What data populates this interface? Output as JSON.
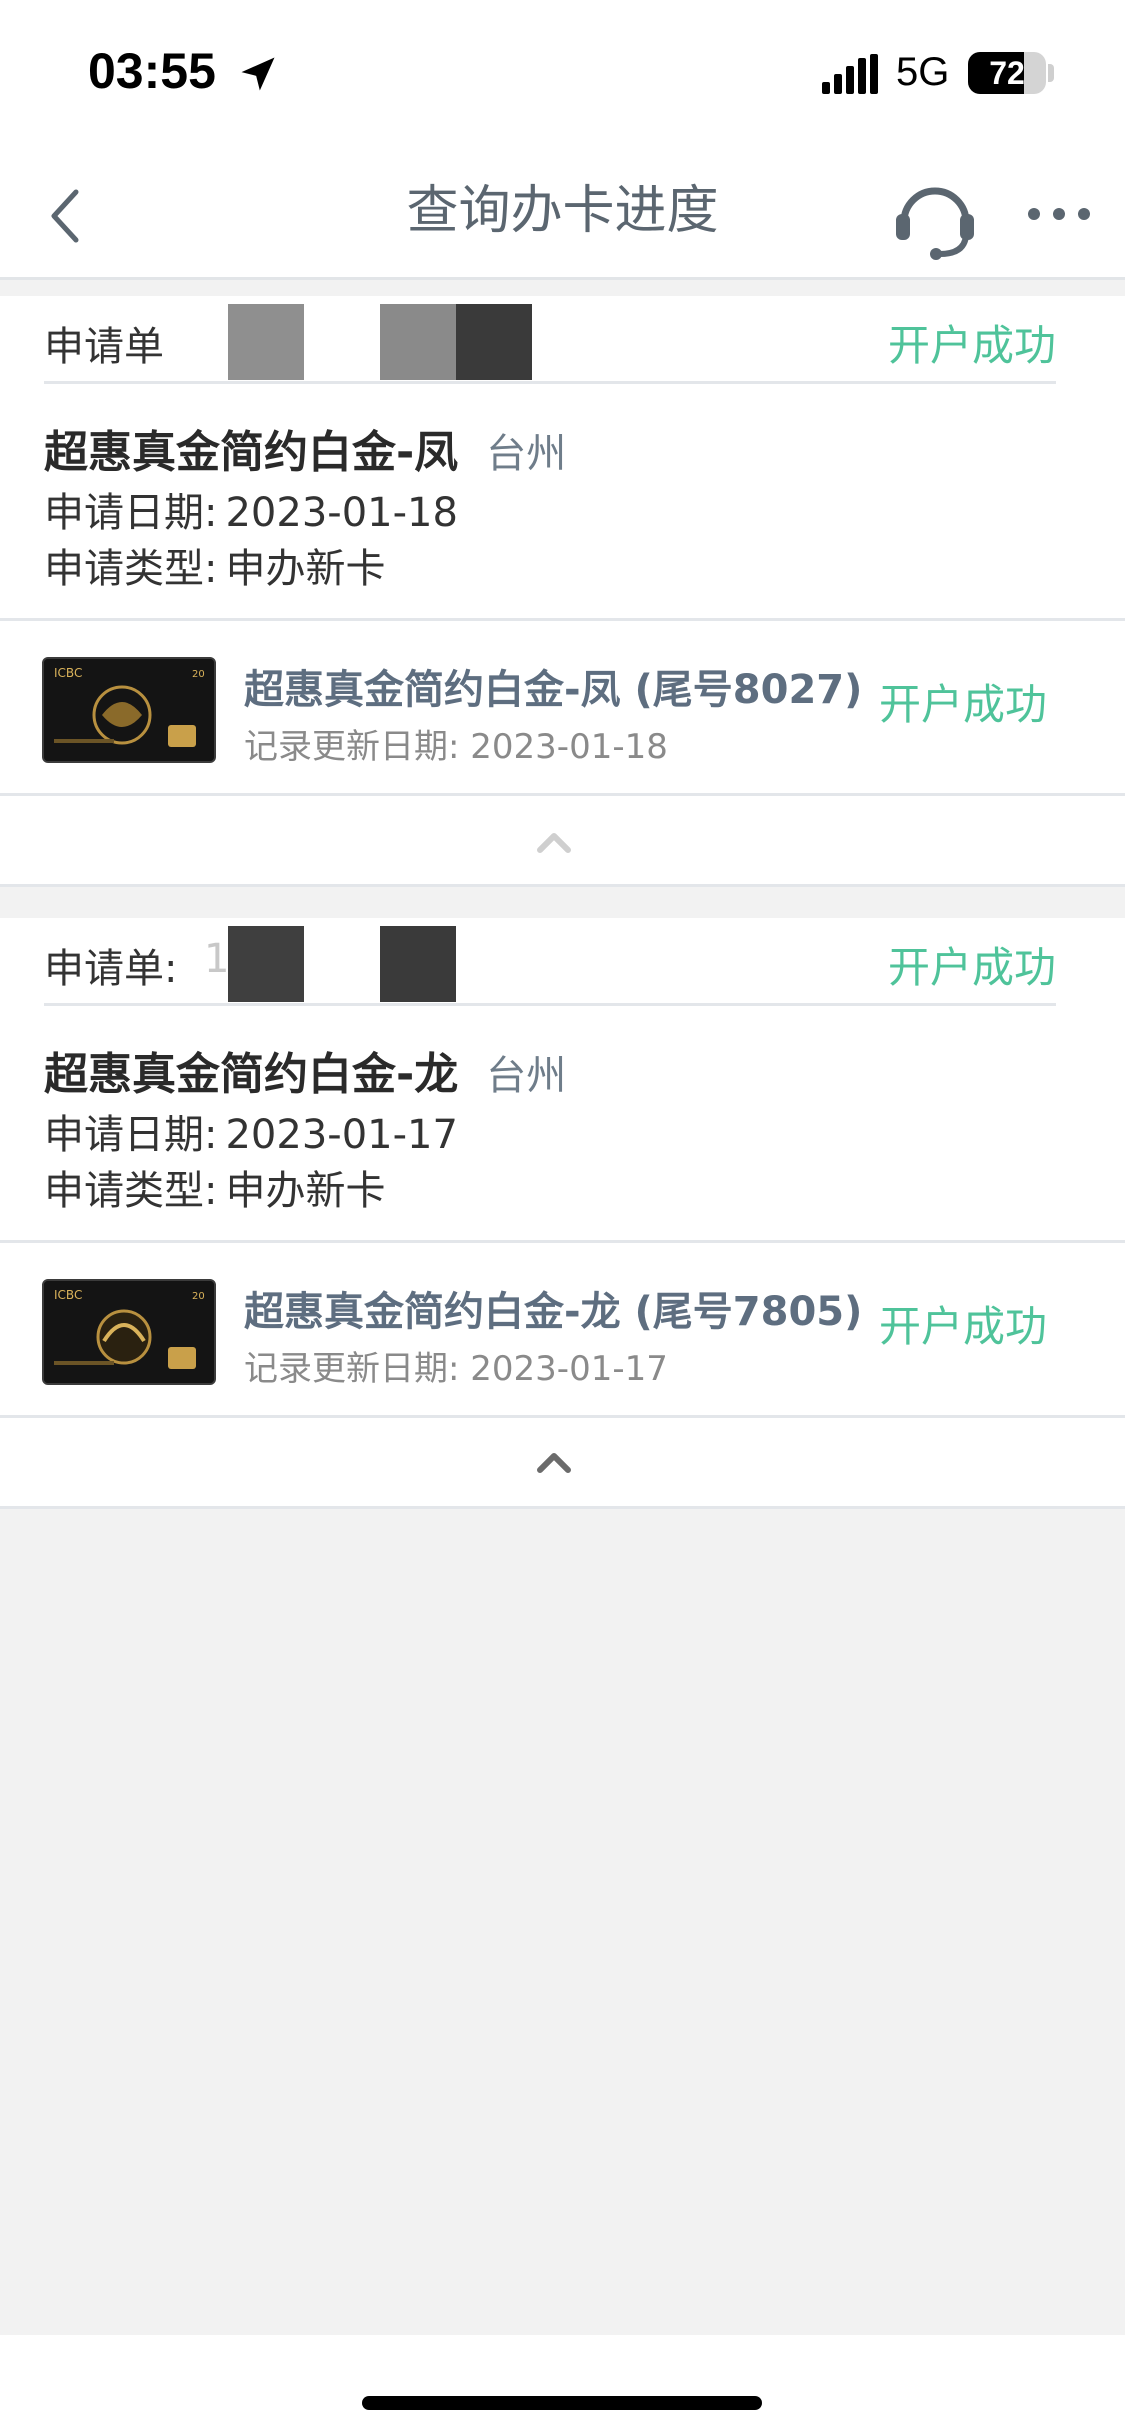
{
  "status_bar": {
    "time": "03:55",
    "network": "5G",
    "battery_percent": "72",
    "battery_level": 0.72
  },
  "nav": {
    "title": "查询办卡进度",
    "back_icon": "chevron-left-icon",
    "service_icon": "headset-icon",
    "more_icon": "more-dots-icon"
  },
  "applications": [
    {
      "no_label": "申请单",
      "no_value": "",
      "status": "开户成功",
      "card_title": "超惠真金简约白金-凤",
      "city": "台州",
      "date_label": "申请日期:",
      "date_value": "2023-01-18",
      "type_label": "申请类型:",
      "type_value": "申办新卡",
      "card": {
        "name": "超惠真金简约白金-凤 (尾号8027)",
        "update_label": "记录更新日期:",
        "update_value": "2023-01-18",
        "status": "开户成功"
      }
    },
    {
      "no_label": "申请单:",
      "no_value": "120",
      "status": "开户成功",
      "card_title": "超惠真金简约白金-龙",
      "city": "台州",
      "date_label": "申请日期:",
      "date_value": "2023-01-17",
      "type_label": "申请类型:",
      "type_value": "申办新卡",
      "card": {
        "name": "超惠真金简约白金-龙 (尾号7805)",
        "update_label": "记录更新日期:",
        "update_value": "2023-01-17",
        "status": "开户成功"
      }
    }
  ],
  "colors": {
    "success_green": "#4fc39a",
    "title_gray": "#5b6670",
    "background": "#f2f2f2"
  }
}
